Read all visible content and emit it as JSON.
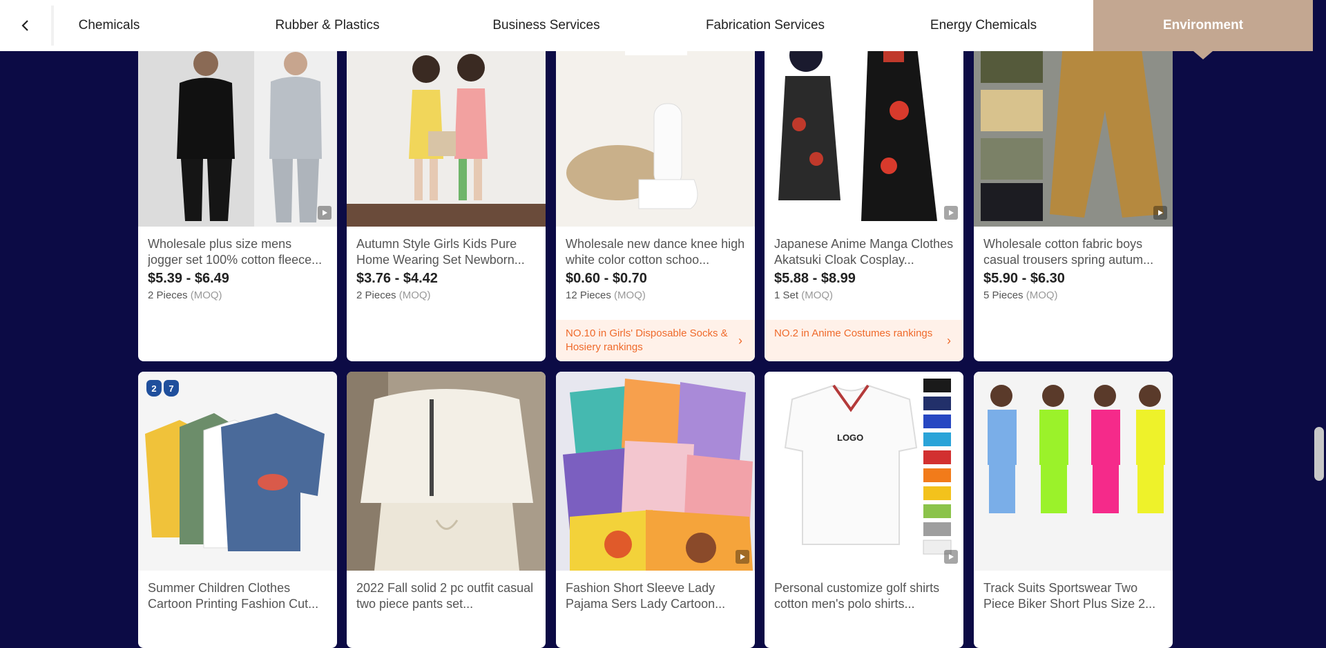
{
  "nav": {
    "tabs": [
      {
        "label": "Chemicals"
      },
      {
        "label": "Rubber & Plastics"
      },
      {
        "label": "Business Services"
      },
      {
        "label": "Fabrication Services"
      },
      {
        "label": "Energy Chemicals"
      },
      {
        "label": "Environment",
        "active": true
      }
    ]
  },
  "colors": {
    "background": "#0c0b45",
    "active_tab": "#c3a791",
    "rank_text": "#ef6a2b",
    "rank_bg": "#fff1e9"
  },
  "products": [
    {
      "title": "Wholesale plus size mens jogger set 100% cotton fleece...",
      "price": "$5.39 - $6.49",
      "moq_qty": "2 Pieces",
      "moq_label": "(MOQ)",
      "video": true,
      "rank": ""
    },
    {
      "title": "Autumn Style Girls Kids Pure Home Wearing Set Newborn...",
      "price": "$3.76 - $4.42",
      "moq_qty": "2 Pieces",
      "moq_label": "(MOQ)",
      "video": false,
      "rank": ""
    },
    {
      "title": "Wholesale new dance knee high white color cotton schoo...",
      "price": "$0.60 - $0.70",
      "moq_qty": "12 Pieces",
      "moq_label": "(MOQ)",
      "video": false,
      "rank": "NO.10 in Girls' Disposable Socks & Hosiery rankings"
    },
    {
      "title": "Japanese Anime Manga Clothes Akatsuki Cloak Cosplay...",
      "price": "$5.88 - $8.99",
      "moq_qty": "1 Set",
      "moq_label": "(MOQ)",
      "video": true,
      "rank": "NO.2 in Anime Costumes rankings"
    },
    {
      "title": "Wholesale cotton fabric boys casual trousers spring autum...",
      "price": "$5.90 - $6.30",
      "moq_qty": "5 Pieces",
      "moq_label": "(MOQ)",
      "video": true,
      "rank": ""
    },
    {
      "title": "Summer Children Clothes Cartoon Printing Fashion Cut...",
      "video": false,
      "badge": [
        "2",
        "7"
      ]
    },
    {
      "title": "2022 Fall solid 2 pc outfit casual two piece pants set...",
      "video": false
    },
    {
      "title": "Fashion Short Sleeve Lady Pajama Sers Lady Cartoon...",
      "video": true
    },
    {
      "title": "Personal customize golf shirts cotton men's polo shirts...",
      "video": true,
      "image_text": "LOGO"
    },
    {
      "title": "Track Suits Sportswear Two Piece Biker Short Plus Size 2...",
      "video": false
    }
  ],
  "icons": {
    "back": "chevron-left-icon",
    "video": "video-play-icon",
    "rank_arrow": "chevron-right-icon",
    "rank_arrow_glyph": "›"
  }
}
